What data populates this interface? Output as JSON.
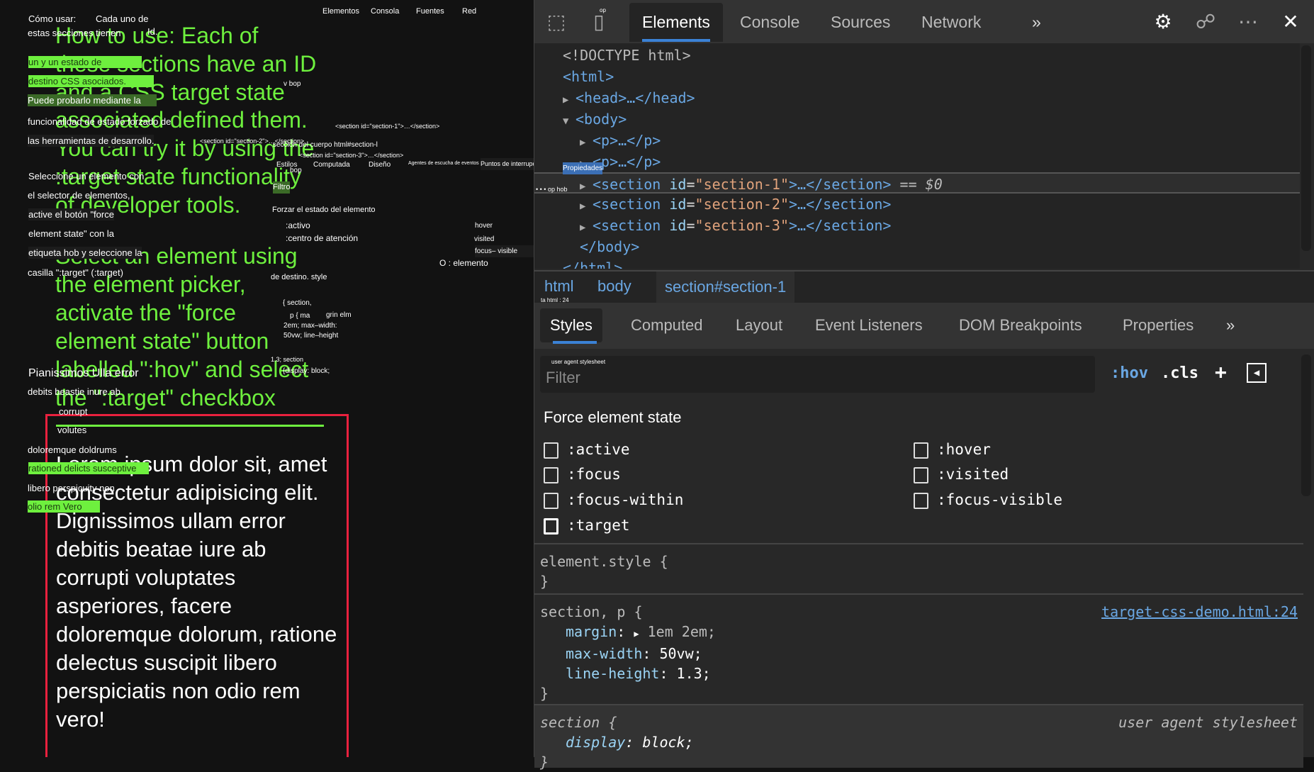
{
  "page": {
    "heading_lines": [
      "How to use: Each of",
      "these sections have an ID",
      "and a CSS target state",
      "associated defined them.",
      "You can try it by using the",
      ":target state functionality",
      "of developer tools.",
      "Select an element using",
      "the element picker,",
      "activate the \"force",
      "element state\" button",
      "labelled \":hov\" and select",
      "the \":target\" checkbox"
    ],
    "lorem": "Lorem ipsum dolor sit, amet consectetur adipisicing elit. Dignissimos ullam error debitis beatae iure ab corrupti voluptates asperiores, facere doloremque dolorum, ratione delectus suscipit libero perspiciatis non odio rem vero!"
  },
  "overlays": [
    "Cómo usar:",
    "Cada uno de",
    "estas secciones tienen",
    "Id.",
    "un y un estado de",
    "destino CSS asociados.",
    "Puede probarlo mediante la",
    "funcionalidad de estado forzado de",
    "las herramientas de desarrollo.",
    "Seleccione un elemento con",
    "el selector de elementos,",
    "active el botón \"force",
    "element state\" con la",
    "etiqueta hob y seleccione la",
    "casilla \":target\" (:target)",
    "Pianissimos Ulla error",
    "debits beastie inure ab",
    "corrupt",
    "volutes",
    "doloremque doldrums",
    "rationed delicts susceptive",
    "libero perspicuity non",
    "olio rem Vero",
    "Elementos",
    "Consola",
    "Fuentes",
    "Red",
    "v bop",
    "<section id=\"section-1\">…</section>",
    "<section id=\"section-2\">…</section>",
    "<section id=\"section-3\">…</section>",
    "bop",
    "sección del cuerpo html#section-l",
    "Estilos",
    "Computada",
    "Diseño",
    "Agentes de escucha de eventos",
    "Puntos de interrupción DOM",
    "Propiedades",
    "• • • op hob",
    "Filtro",
    "Forzar el estado del elemento",
    ":activo",
    ":centro de atención",
    "hover",
    "visited",
    "focus– visible",
    "O : elemento",
    "de destino. style",
    "{ section,",
    "p { ma",
    "grin elm",
    "2em; max–width:",
    "50vw; line–height",
    "1.3; section",
    "{display: block;",
    "ta html : 24",
    "user agent stylesheet",
    "op"
  ],
  "devtools": {
    "tabs": [
      "Elements",
      "Console",
      "Sources",
      "Network"
    ],
    "more": "»",
    "dom": {
      "doctype": "<!DOCTYPE html>",
      "html_open": "<html>",
      "head": "<head>…</head>",
      "body_open": "<body>",
      "p1": "<p>…</p>",
      "p2": "<p>…</p>",
      "sections": [
        {
          "id": "section-1"
        },
        {
          "id": "section-2"
        },
        {
          "id": "section-3"
        }
      ],
      "section_tag": "<section",
      "attr": "id",
      "close": ">…</section>",
      "eq": "== $0",
      "body_close": "</body>",
      "html_close": "</html>"
    },
    "breadcrumbs": [
      "html",
      "body",
      "section#section-1"
    ],
    "subtabs": [
      "Styles",
      "Computed",
      "Layout",
      "Event Listeners",
      "DOM Breakpoints",
      "Properties"
    ],
    "filter_placeholder": "Filter",
    "hov": ":hov",
    "cls": ".cls",
    "plus": "+",
    "force_title": "Force element state",
    "states_left": [
      ":active",
      ":focus",
      ":focus-within",
      ":target"
    ],
    "states_right": [
      ":hover",
      ":visited",
      ":focus-visible"
    ],
    "rules": {
      "element_style": "element.style {",
      "close": "}",
      "r1_selector": "section, p {",
      "r1_source": "target-css-demo.html:24",
      "r1_props": [
        {
          "name": "margin",
          "value": "1em 2em;"
        },
        {
          "name": "max-width",
          "value": "50vw;"
        },
        {
          "name": "line-height",
          "value": "1.3;"
        }
      ],
      "r2_selector": "section {",
      "r2_source": "user agent stylesheet",
      "r2_props": [
        {
          "name": "display",
          "value": "block;"
        }
      ]
    }
  }
}
